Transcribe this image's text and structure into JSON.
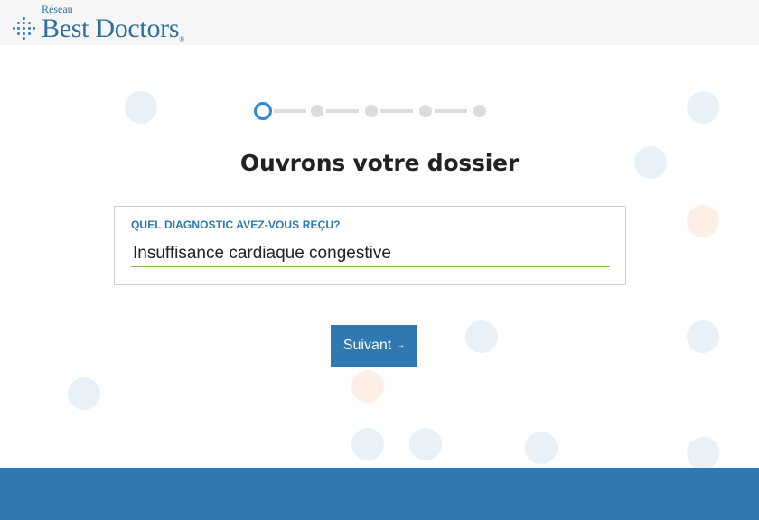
{
  "header": {
    "logo_network": "Réseau",
    "logo_name": "Best Doctors",
    "logo_reg": "®"
  },
  "stepper": {
    "total_steps": 5,
    "current_step": 1
  },
  "main": {
    "title": "Ouvrons votre dossier",
    "field_label": "QUEL DIAGNOSTIC AVEZ-VOUS REÇU?",
    "field_value": "Insuffisance cardiaque congestive",
    "next_button_label": "Suivant",
    "next_button_icon": "→"
  },
  "colors": {
    "brand_blue": "#2f78b1",
    "label_blue": "#2e77b0",
    "active_step": "#2f8ad7",
    "input_underline": "#7cc24c",
    "dot_blue": "#e8f0f8",
    "dot_orange": "#fdeee6"
  }
}
